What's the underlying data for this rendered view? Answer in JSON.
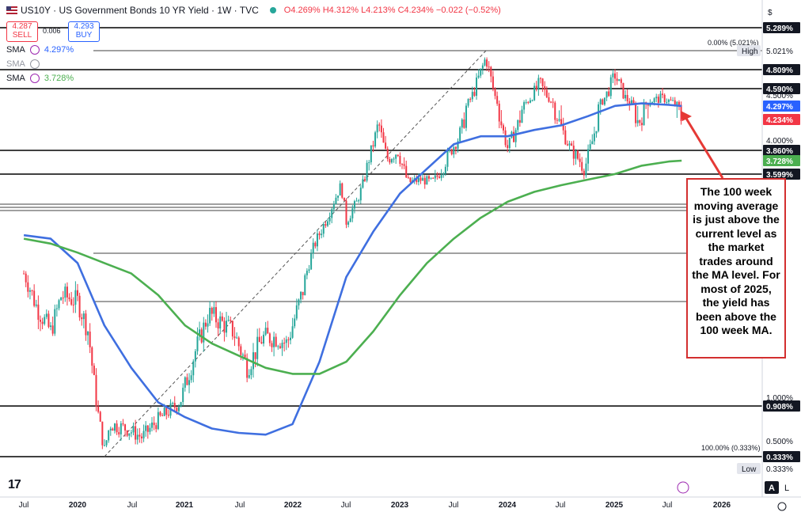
{
  "header": {
    "title": "US10Y · US Government Bonds 10 YR Yield · 1W · TVC",
    "open": "O4.269%",
    "high": "H4.312%",
    "low": "L4.213%",
    "close": "C4.234%",
    "change": "−0.022 (−0.52%)"
  },
  "trade": {
    "sell_price": "4.287",
    "sell_label": "SELL",
    "spread": "0.006",
    "buy_price": "4.293",
    "buy_label": "BUY"
  },
  "indicators": [
    {
      "label": "SMA",
      "value": "4.297%",
      "color": "#2962ff"
    },
    {
      "label": "SMA",
      "value": "",
      "color": "#9598a1"
    },
    {
      "label": "SMA",
      "value": "3.728%",
      "color": "#4caf50"
    }
  ],
  "annotation": "The 100 week moving average is just above the current level as the market trades around the MA level. For most of 2025, the yield has been above the 100 week MA.",
  "toolbar": {
    "auto_label": "A"
  },
  "chart_data": {
    "type": "line",
    "series": [
      {
        "values": [
          [
            2019.5,
            2.05
          ],
          [
            2019.62,
            1.75
          ],
          [
            2019.75,
            1.55
          ],
          [
            2019.85,
            1.85
          ],
          [
            2020.0,
            1.8
          ],
          [
            2020.1,
            1.55
          ],
          [
            2020.2,
            0.75
          ],
          [
            2020.25,
            0.4
          ],
          [
            2020.3,
            0.7
          ],
          [
            2020.45,
            0.65
          ],
          [
            2020.6,
            0.55
          ],
          [
            2020.75,
            0.75
          ],
          [
            2020.95,
            0.95
          ],
          [
            2021.1,
            1.4
          ],
          [
            2021.22,
            1.7
          ],
          [
            2021.45,
            1.55
          ],
          [
            2021.58,
            1.25
          ],
          [
            2021.72,
            1.5
          ],
          [
            2021.85,
            1.5
          ],
          [
            2021.95,
            1.45
          ],
          [
            2022.1,
            1.9
          ],
          [
            2022.2,
            2.45
          ],
          [
            2022.35,
            2.95
          ],
          [
            2022.45,
            3.4
          ],
          [
            2022.5,
            2.8
          ],
          [
            2022.6,
            3.1
          ],
          [
            2022.7,
            3.7
          ],
          [
            2022.8,
            4.2
          ],
          [
            2022.88,
            3.75
          ],
          [
            2022.98,
            3.85
          ],
          [
            2023.08,
            3.45
          ],
          [
            2023.2,
            3.5
          ],
          [
            2023.3,
            3.45
          ],
          [
            2023.45,
            3.8
          ],
          [
            2023.55,
            4.05
          ],
          [
            2023.7,
            4.6
          ],
          [
            2023.8,
            4.95
          ],
          [
            2023.9,
            4.4
          ],
          [
            2024.0,
            3.9
          ],
          [
            2024.12,
            4.25
          ],
          [
            2024.3,
            4.65
          ],
          [
            2024.45,
            4.3
          ],
          [
            2024.6,
            3.85
          ],
          [
            2024.72,
            3.65
          ],
          [
            2024.85,
            4.3
          ],
          [
            2025.0,
            4.75
          ],
          [
            2025.1,
            4.45
          ],
          [
            2025.22,
            4.2
          ],
          [
            2025.32,
            4.4
          ],
          [
            2025.45,
            4.45
          ],
          [
            2025.55,
            4.35
          ],
          [
            2025.62,
            4.234
          ]
        ]
      },
      {
        "name": "SMA",
        "values": [
          [
            2019.5,
            2.6
          ],
          [
            2019.75,
            2.55
          ],
          [
            2020.0,
            2.2
          ],
          [
            2020.25,
            1.6
          ],
          [
            2020.5,
            1.25
          ],
          [
            2020.75,
            0.95
          ],
          [
            2021.0,
            0.78
          ],
          [
            2021.25,
            0.65
          ],
          [
            2021.5,
            0.6
          ],
          [
            2021.75,
            0.58
          ],
          [
            2022.0,
            0.7
          ],
          [
            2022.25,
            1.3
          ],
          [
            2022.5,
            2.0
          ],
          [
            2022.75,
            2.65
          ],
          [
            2023.0,
            3.25
          ],
          [
            2023.25,
            3.65
          ],
          [
            2023.5,
            3.95
          ],
          [
            2023.75,
            4.05
          ],
          [
            2024.0,
            4.05
          ],
          [
            2024.25,
            4.12
          ],
          [
            2024.5,
            4.17
          ],
          [
            2024.75,
            4.25
          ],
          [
            2025.0,
            4.3
          ],
          [
            2025.25,
            4.35
          ],
          [
            2025.5,
            4.32
          ],
          [
            2025.62,
            4.297
          ]
        ]
      },
      {
        "name": "SMA",
        "values": [
          [
            2019.5,
            2.55
          ],
          [
            2019.75,
            2.48
          ],
          [
            2020.0,
            2.35
          ],
          [
            2020.25,
            2.2
          ],
          [
            2020.5,
            2.05
          ],
          [
            2020.75,
            1.85
          ],
          [
            2021.0,
            1.6
          ],
          [
            2021.25,
            1.45
          ],
          [
            2021.5,
            1.35
          ],
          [
            2021.75,
            1.25
          ],
          [
            2022.0,
            1.2
          ],
          [
            2022.25,
            1.2
          ],
          [
            2022.5,
            1.3
          ],
          [
            2022.75,
            1.55
          ],
          [
            2023.0,
            1.85
          ],
          [
            2023.25,
            2.2
          ],
          [
            2023.5,
            2.55
          ],
          [
            2023.75,
            2.85
          ],
          [
            2024.0,
            3.1
          ],
          [
            2024.25,
            3.28
          ],
          [
            2024.5,
            3.4
          ],
          [
            2024.75,
            3.5
          ],
          [
            2025.0,
            3.6
          ],
          [
            2025.25,
            3.68
          ],
          [
            2025.5,
            3.72
          ],
          [
            2025.62,
            3.728
          ]
        ]
      }
    ],
    "horizontal_levels": [
      {
        "value": 5.289,
        "label": "5.289%"
      },
      {
        "value": 4.809,
        "label": "4.809%"
      },
      {
        "value": 4.59,
        "label": "4.590%"
      },
      {
        "value": 3.86,
        "label": "3.860%"
      },
      {
        "value": 3.599,
        "label": "3.599%"
      },
      {
        "value": 0.908,
        "label": "0.908%"
      },
      {
        "value": 0.333,
        "label": "0.333%"
      }
    ],
    "fib_labels": [
      "0.00% (5.021%)",
      "100.00% (0.333%)"
    ],
    "price_tags": [
      {
        "label": "5.289%",
        "color": "#131722",
        "text": "#ffffff"
      },
      {
        "label": "High",
        "color": "#e3e5ec",
        "text": "#131722",
        "value": "5.021%"
      },
      {
        "label": "4.809%",
        "color": "#131722",
        "text": "#ffffff"
      },
      {
        "label": "4.590%",
        "color": "#131722",
        "text": "#ffffff"
      },
      {
        "label": "4.297%",
        "color": "#2962ff",
        "text": "#ffffff"
      },
      {
        "label": "4.234%",
        "color": "#f23645",
        "text": "#ffffff"
      },
      {
        "label": "3.860%",
        "color": "#131722",
        "text": "#ffffff"
      },
      {
        "label": "3.728%",
        "color": "#4caf50",
        "text": "#ffffff"
      },
      {
        "label": "3.599%",
        "color": "#131722",
        "text": "#ffffff"
      },
      {
        "label": "0.908%",
        "color": "#131722",
        "text": "#ffffff"
      },
      {
        "label": "0.333%",
        "color": "#131722",
        "text": "#ffffff"
      },
      {
        "label": "Low",
        "color": "#e3e5ec",
        "text": "#131722",
        "value": "0.333%"
      }
    ],
    "y_ticks": [
      "4.500%",
      "4.000%",
      "1.000%",
      "0.500%"
    ],
    "x_ticks": [
      "Jul",
      "2020",
      "Jul",
      "2021",
      "Jul",
      "2022",
      "Jul",
      "2023",
      "Jul",
      "2024",
      "Jul",
      "2025",
      "Jul",
      "2026"
    ],
    "colors": {
      "up": "#26a69a",
      "down": "#f23645",
      "arrow": "#e53935"
    }
  }
}
